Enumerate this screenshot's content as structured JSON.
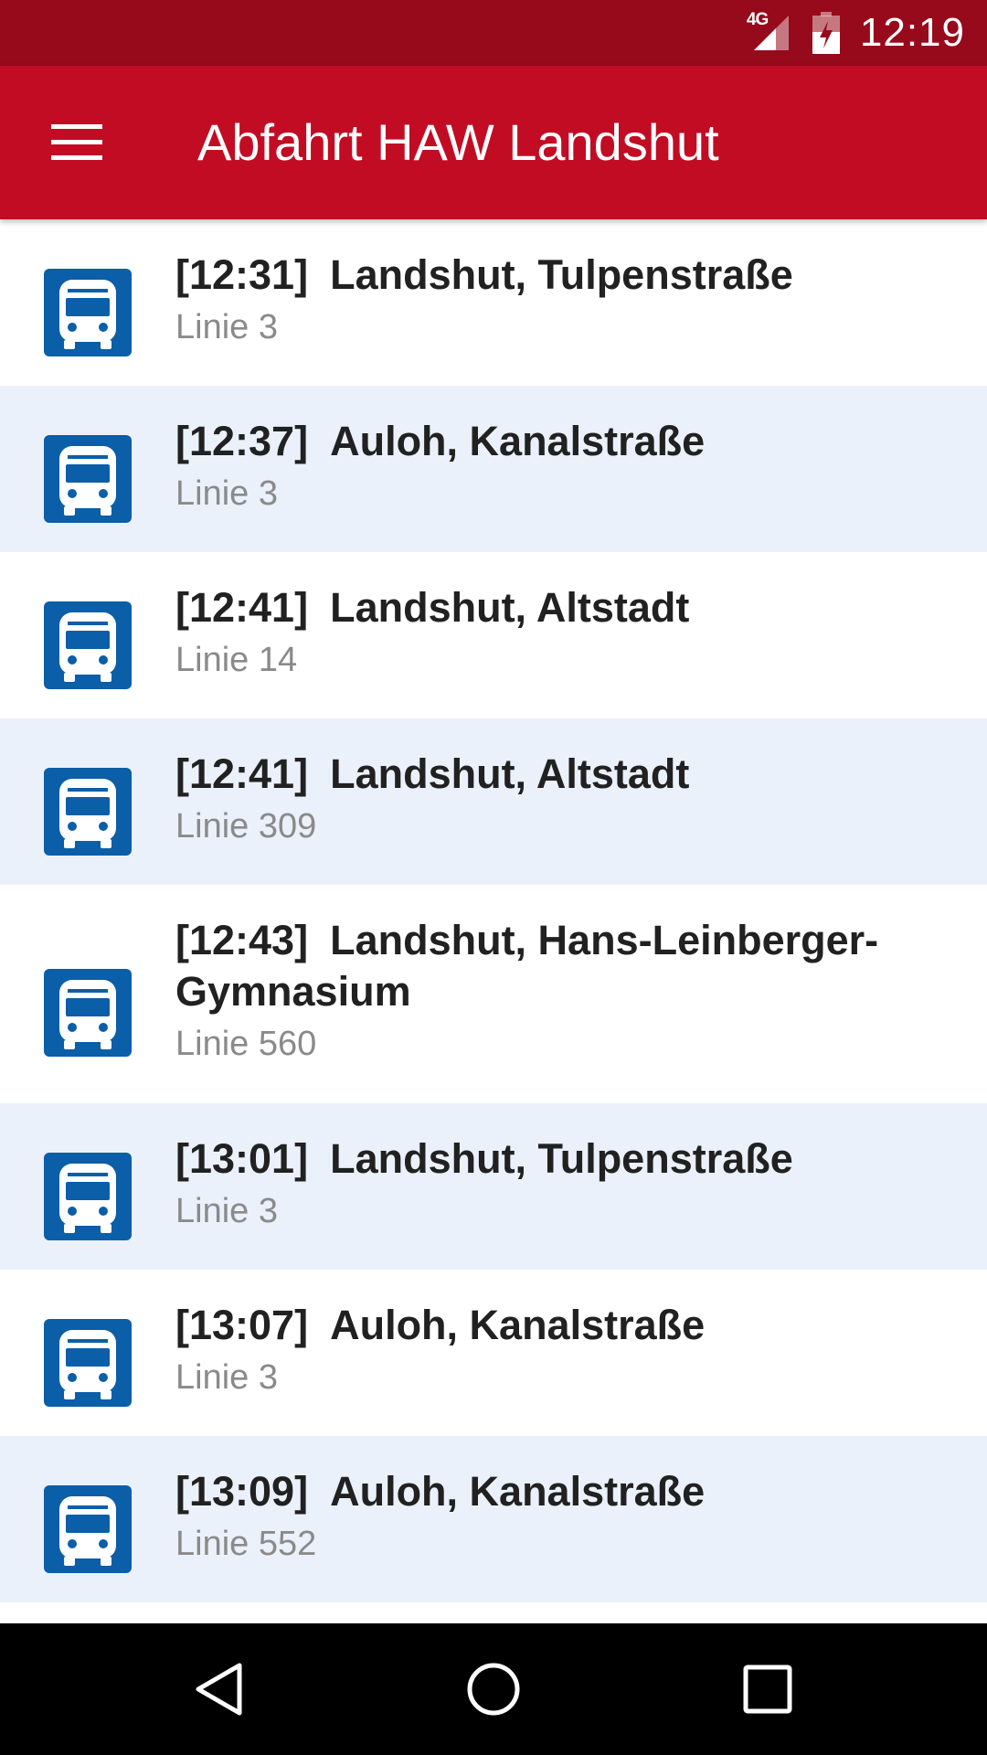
{
  "status_bar": {
    "network": "4G",
    "time": "12:19"
  },
  "app_bar": {
    "title": "Abfahrt HAW Landshut",
    "menu_icon": "hamburger-menu-icon"
  },
  "colors": {
    "status_bar": "#970a1b",
    "app_bar": "#c20c24",
    "alt_row": "#ebf1fa",
    "bus_icon": "#0b5ea8"
  },
  "departures": [
    {
      "time": "[12:31]",
      "destination": "Landshut, Tulpenstraße",
      "line": "Linie 3"
    },
    {
      "time": "[12:37]",
      "destination": "Auloh, Kanalstraße",
      "line": "Linie 3"
    },
    {
      "time": "[12:41]",
      "destination": "Landshut, Altstadt",
      "line": "Linie 14"
    },
    {
      "time": "[12:41]",
      "destination": "Landshut, Altstadt",
      "line": "Linie 309"
    },
    {
      "time": "[12:43]",
      "destination": "Landshut, Hans-Leinberger-Gymnasium",
      "line": "Linie 560"
    },
    {
      "time": "[13:01]",
      "destination": "Landshut, Tulpenstraße",
      "line": "Linie 3"
    },
    {
      "time": "[13:07]",
      "destination": "Auloh, Kanalstraße",
      "line": "Linie 3"
    },
    {
      "time": "[13:09]",
      "destination": "Auloh, Kanalstraße",
      "line": "Linie 552"
    }
  ],
  "nav_bar": {
    "back_icon": "back-triangle-icon",
    "home_icon": "home-circle-icon",
    "recents_icon": "recents-square-icon"
  }
}
